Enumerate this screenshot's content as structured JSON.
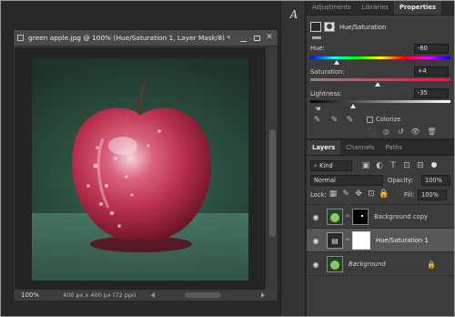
{
  "document": {
    "title": "green apple.jpg @ 100% (Hue/Saturation 1, Layer Mask/8) *",
    "zoom": "100%",
    "size_info": "400 px x 400 px (72 ppi)"
  },
  "right_panel": {
    "tabs": [
      "Adjustments",
      "Libraries",
      "Properties"
    ],
    "active_tab": "Properties"
  },
  "properties": {
    "adjustment_name": "Hue/Saturation",
    "hue": {
      "label": "Hue:",
      "value": "-80"
    },
    "saturation": {
      "label": "Saturation:",
      "value": "+4"
    },
    "lightness": {
      "label": "Lightness:",
      "value": "-35"
    },
    "colorize_label": "Colorize"
  },
  "layers_panel": {
    "tabs": [
      "Layers",
      "Channels",
      "Paths"
    ],
    "active_tab": "Layers",
    "filter_kind": "Kind",
    "blend_mode": "Normal",
    "opacity_label": "Opacity:",
    "opacity_value": "100%",
    "lock_label": "Lock:",
    "fill_label": "Fill:",
    "fill_value": "100%",
    "layers": [
      {
        "name": "Background copy"
      },
      {
        "name": "Hue/Saturation 1"
      },
      {
        "name": "Background"
      }
    ]
  },
  "colors": {
    "selected_row": "#575757",
    "panel_bg": "#3c3c3c",
    "apple_red": "#c0405a"
  },
  "icons": [
    "close-icon",
    "restore-icon",
    "minimize-icon",
    "character-panel-icon",
    "adjustment-layer-icon",
    "mask-icon",
    "eyedropper-icon",
    "eyedropper-plus-icon",
    "eyedropper-minus-icon",
    "hand-target-icon",
    "clip-icon",
    "visibility-toggle-icon",
    "reset-icon",
    "eye-icon",
    "trash-icon",
    "lock-icon",
    "chain-link-icon",
    "search-icon"
  ]
}
